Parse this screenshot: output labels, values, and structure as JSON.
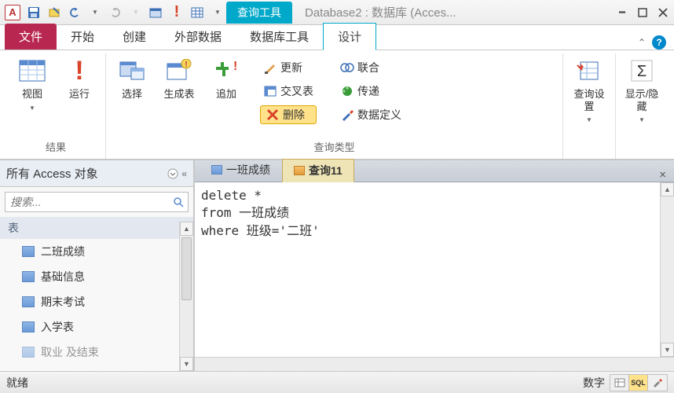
{
  "app_letter": "A",
  "context_tab": "查询工具",
  "window_title": "Database2 : 数据库 (Acces...",
  "tabs": {
    "file": "文件",
    "home": "开始",
    "create": "创建",
    "external": "外部数据",
    "dbtools": "数据库工具",
    "design": "设计"
  },
  "ribbon": {
    "results": {
      "view": "视图",
      "run": "运行",
      "group": "结果"
    },
    "query_type": {
      "select": "选择",
      "make_table": "生成表",
      "append": "追加",
      "update": "更新",
      "union": "联合",
      "crosstab": "交叉表",
      "passthrough": "传递",
      "delete": "删除",
      "data_def": "数据定义",
      "group": "查询类型"
    },
    "setup": {
      "label": "查询设置"
    },
    "showhide": {
      "label": "显示/隐藏"
    }
  },
  "nav": {
    "title": "所有 Access 对象",
    "search_placeholder": "搜索...",
    "group_tables": "表",
    "items": [
      "二班成绩",
      "基础信息",
      "期末考试",
      "入学表"
    ],
    "item_cut": "取业 及结束"
  },
  "docs": {
    "tab1": "一班成绩",
    "tab2": "查询11"
  },
  "sql": "delete *\nfrom 一班成绩\nwhere 班级='二班'",
  "status": {
    "ready": "就绪",
    "numlock": "数字",
    "sql_btn": "SQL"
  }
}
